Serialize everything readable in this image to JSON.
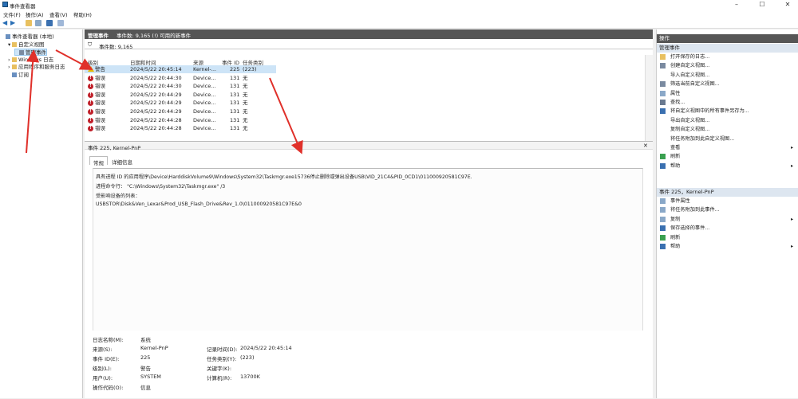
{
  "window": {
    "title": "事件查看器",
    "min": "–",
    "max": "☐",
    "close": "✕"
  },
  "menu": [
    "文件(F)",
    "操作(A)",
    "查看(V)",
    "帮助(H)"
  ],
  "tree": [
    {
      "label": "事件查看器 (本地)",
      "indent": 0,
      "icon": "computer-icon",
      "exp": ""
    },
    {
      "label": "自定义视图",
      "indent": 1,
      "icon": "folder-icon",
      "exp": "▾"
    },
    {
      "label": "管理事件",
      "indent": 2,
      "icon": "filter-icon",
      "exp": "",
      "selected": true
    },
    {
      "label": "Windows 日志",
      "indent": 1,
      "icon": "folder-icon",
      "exp": "›"
    },
    {
      "label": "应用程序和服务日志",
      "indent": 1,
      "icon": "folder-icon",
      "exp": "›"
    },
    {
      "label": "订阅",
      "indent": 1,
      "icon": "subscription-icon",
      "exp": ""
    }
  ],
  "center": {
    "header_title": "管理事件",
    "header_info": "事件数: 9,165 (!) 可用的新事件",
    "filter_text": "事件数: 9,165",
    "columns": [
      "级别",
      "日期和时间",
      "来源",
      "事件 ID",
      "任务类别"
    ],
    "rows": [
      {
        "level": "警告",
        "type": "warning",
        "datetime": "2024/5/22 20:45:14",
        "source": "Kernel-...",
        "id": "225",
        "task": "(223)",
        "selected": true
      },
      {
        "level": "错误",
        "type": "error",
        "datetime": "2024/5/22 20:44:30",
        "source": "Device...",
        "id": "131",
        "task": "无"
      },
      {
        "level": "错误",
        "type": "error",
        "datetime": "2024/5/22 20:44:30",
        "source": "Device...",
        "id": "131",
        "task": "无"
      },
      {
        "level": "错误",
        "type": "error",
        "datetime": "2024/5/22 20:44:29",
        "source": "Device...",
        "id": "131",
        "task": "无"
      },
      {
        "level": "错误",
        "type": "error",
        "datetime": "2024/5/22 20:44:29",
        "source": "Device...",
        "id": "131",
        "task": "无"
      },
      {
        "level": "错误",
        "type": "error",
        "datetime": "2024/5/22 20:44:29",
        "source": "Device...",
        "id": "131",
        "task": "无"
      },
      {
        "level": "错误",
        "type": "error",
        "datetime": "2024/5/22 20:44:28",
        "source": "Device...",
        "id": "131",
        "task": "无"
      },
      {
        "level": "错误",
        "type": "error",
        "datetime": "2024/5/22 20:44:28",
        "source": "Device...",
        "id": "131",
        "task": "无"
      }
    ]
  },
  "detail": {
    "header": "事件 225, Kernel-PnP",
    "close": "✕",
    "tabs": [
      "常规",
      "详细信息"
    ],
    "lines": [
      "具有进程 ID 的应用程序\\Device\\HarddiskVolume9\\Windows\\System32\\Taskmgr.exe15736停止删除或弹出设备USB\\VID_21C4&PID_0CD1\\011000920581C97E.",
      "进程命令行：  \"C:\\Windows\\System32\\Taskmgr.exe\" /3",
      "受影响设备的列表：",
      "USBSTOR\\Disk&Ven_Lexar&Prod_USB_Flash_Drive&Rev_1.0\\011000920581C97E&0"
    ],
    "fields_left": [
      {
        "label": "日志名称(M):",
        "value": "系统"
      },
      {
        "label": "来源(S):",
        "value": "Kernel-PnP"
      },
      {
        "label": "事件 ID(E):",
        "value": "225"
      },
      {
        "label": "级别(L):",
        "value": "警告"
      },
      {
        "label": "用户(U):",
        "value": "SYSTEM"
      },
      {
        "label": "操作代码(O):",
        "value": "信息"
      }
    ],
    "fields_right": [
      {
        "label": "",
        "value": ""
      },
      {
        "label": "记录时间(D):",
        "value": "2024/5/22 20:45:14"
      },
      {
        "label": "任务类别(Y):",
        "value": "(223)"
      },
      {
        "label": "关键字(K):",
        "value": ""
      },
      {
        "label": "计算机(R):",
        "value": "13700K"
      },
      {
        "label": "",
        "value": ""
      }
    ]
  },
  "actions": {
    "header": "操作",
    "section1": "管理事件",
    "items1": [
      {
        "label": "打开保存的日志...",
        "icon": "open-log-icon"
      },
      {
        "label": "创建自定义视图...",
        "icon": "filter-icon"
      },
      {
        "label": "导入自定义视图...",
        "icon": ""
      },
      {
        "label": "筛选当前自定义视图...",
        "icon": "filter-icon"
      },
      {
        "label": "属性",
        "icon": "properties-icon"
      },
      {
        "label": "查找...",
        "icon": "find-icon"
      },
      {
        "label": "将自定义视图中的所有事件另存为...",
        "icon": "save-icon"
      },
      {
        "label": "导出自定义视图...",
        "icon": ""
      },
      {
        "label": "复制自定义视图...",
        "icon": ""
      },
      {
        "label": "将任务附加到此自定义视图...",
        "icon": ""
      },
      {
        "label": "查看",
        "icon": "",
        "arrow": "▸"
      },
      {
        "label": "刷新",
        "icon": "refresh-icon"
      },
      {
        "label": "帮助",
        "icon": "help-icon",
        "arrow": "▸"
      }
    ],
    "section2": "事件 225，Kernel-PnP",
    "items2": [
      {
        "label": "事件属性",
        "icon": "properties-icon"
      },
      {
        "label": "将任务附加到此事件...",
        "icon": "task-icon"
      },
      {
        "label": "复制",
        "icon": "copy-icon",
        "arrow": "▸"
      },
      {
        "label": "保存选择的事件...",
        "icon": "save-icon"
      },
      {
        "label": "刷新",
        "icon": "refresh-icon"
      },
      {
        "label": "帮助",
        "icon": "help-icon",
        "arrow": "▸"
      }
    ]
  },
  "colors": {
    "accent": "#2a6fb5",
    "error": "#c0202a",
    "warning": "#e6b800",
    "header_dark": "#565656",
    "annotation": "#e0302a"
  }
}
